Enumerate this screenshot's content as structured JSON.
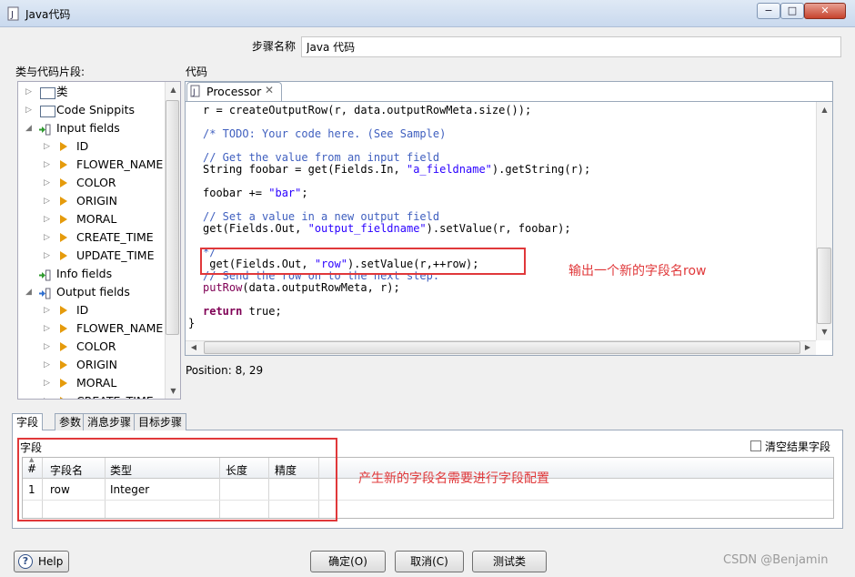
{
  "window": {
    "title": "Java代码",
    "title_icon": "document-j-icon",
    "controls": {
      "minimize": "−",
      "maximize": "□",
      "close": "✕"
    }
  },
  "step_name": {
    "label": "步骤名称",
    "value": "Java 代码"
  },
  "tree": {
    "label": "类与代码片段:",
    "items": [
      {
        "label": "类",
        "icon": "folder-icon",
        "expander": "▷",
        "level": 1
      },
      {
        "label": "Code Snippits",
        "icon": "folder-icon",
        "expander": "▷",
        "level": 1
      },
      {
        "label": "Input fields",
        "icon": "input-fields-icon",
        "expander": "◢",
        "level": 1
      },
      {
        "label": "ID",
        "icon": "field-icon",
        "expander": "▷",
        "level": 2
      },
      {
        "label": "FLOWER_NAME",
        "icon": "field-icon",
        "expander": "▷",
        "level": 2
      },
      {
        "label": "COLOR",
        "icon": "field-icon",
        "expander": "▷",
        "level": 2
      },
      {
        "label": "ORIGIN",
        "icon": "field-icon",
        "expander": "▷",
        "level": 2
      },
      {
        "label": "MORAL",
        "icon": "field-icon",
        "expander": "▷",
        "level": 2
      },
      {
        "label": "CREATE_TIME",
        "icon": "field-icon",
        "expander": "▷",
        "level": 2
      },
      {
        "label": "UPDATE_TIME",
        "icon": "field-icon",
        "expander": "▷",
        "level": 2
      },
      {
        "label": "Info fields",
        "icon": "info-fields-icon",
        "expander": "",
        "level": 1
      },
      {
        "label": "Output fields",
        "icon": "output-fields-icon",
        "expander": "◢",
        "level": 1
      },
      {
        "label": "ID",
        "icon": "field-icon",
        "expander": "▷",
        "level": 2
      },
      {
        "label": "FLOWER_NAME",
        "icon": "field-icon",
        "expander": "▷",
        "level": 2
      },
      {
        "label": "COLOR",
        "icon": "field-icon",
        "expander": "▷",
        "level": 2
      },
      {
        "label": "ORIGIN",
        "icon": "field-icon",
        "expander": "▷",
        "level": 2
      },
      {
        "label": "MORAL",
        "icon": "field-icon",
        "expander": "▷",
        "level": 2
      },
      {
        "label": "CREATE_TIME",
        "icon": "field-icon",
        "expander": "▷",
        "level": 2
      }
    ]
  },
  "editor": {
    "label": "代码",
    "tab": "Processor",
    "tab_close": "✕",
    "position": "Position: 8, 29",
    "lines": [
      {
        "row": 0,
        "segments": [
          {
            "t": "r = createOutputRow(r, data.outputRowMeta.size());",
            "c": "plain"
          }
        ]
      },
      {
        "row": 2,
        "segments": [
          {
            "t": "/* TODO: Your code here. (See Sample)",
            "c": "comment"
          }
        ]
      },
      {
        "row": 4,
        "segments": [
          {
            "t": "// Get the value from an input field",
            "c": "comment"
          }
        ]
      },
      {
        "row": 5,
        "segments": [
          {
            "t": "String foobar = get(Fields.In, ",
            "c": "plain"
          },
          {
            "t": "\"a_fieldname\"",
            "c": "string"
          },
          {
            "t": ").getString(r);",
            "c": "plain"
          }
        ]
      },
      {
        "row": 7,
        "segments": [
          {
            "t": "foobar += ",
            "c": "plain"
          },
          {
            "t": "\"bar\"",
            "c": "string"
          },
          {
            "t": ";",
            "c": "plain"
          }
        ]
      },
      {
        "row": 9,
        "segments": [
          {
            "t": "// Set a value in a new output field",
            "c": "comment"
          }
        ]
      },
      {
        "row": 10,
        "segments": [
          {
            "t": "get(Fields.Out, ",
            "c": "plain"
          },
          {
            "t": "\"output_fieldname\"",
            "c": "string"
          },
          {
            "t": ").setValue(r, foobar);",
            "c": "plain"
          }
        ]
      },
      {
        "row": 12,
        "segments": [
          {
            "t": "*/",
            "c": "comment"
          }
        ]
      },
      {
        "row": 13,
        "segments": [
          {
            "t": " get(Fields.Out, ",
            "c": "plain"
          },
          {
            "t": "\"row\"",
            "c": "string"
          },
          {
            "t": ").setValue(r,++row);",
            "c": "plain"
          }
        ]
      },
      {
        "row": 14,
        "segments": [
          {
            "t": "// Send the row on to the next step.",
            "c": "comment"
          }
        ]
      },
      {
        "row": 15,
        "segments": [
          {
            "t": "putRow",
            "c": "call"
          },
          {
            "t": "(data.outputRowMeta, r);",
            "c": "plain"
          }
        ]
      },
      {
        "row": 17,
        "segments": [
          {
            "t": "return",
            "c": "kw"
          },
          {
            "t": " true;",
            "c": "plain"
          }
        ]
      },
      {
        "row": 18,
        "segments": [
          {
            "t": "}",
            "c": "plain"
          }
        ],
        "outdent": true
      }
    ]
  },
  "annotations": {
    "code_note": "输出一个新的字段名row",
    "fields_note": "产生新的字段名需要进行字段配置",
    "color": "#e0383a"
  },
  "bottom_tabs": [
    "字段",
    "参数",
    "消息步骤",
    "目标步骤"
  ],
  "fields_panel": {
    "title": "字段",
    "clear_label": "清空结果字段",
    "clear_checked": false,
    "columns": [
      "#",
      "字段名",
      "类型",
      "长度",
      "精度"
    ],
    "rows": [
      [
        "1",
        "row",
        "Integer",
        "",
        ""
      ]
    ]
  },
  "buttons": {
    "help": "Help",
    "ok": "确定(O)",
    "cancel": "取消(C)",
    "test": "测试类"
  },
  "watermark": "CSDN @Benjamin"
}
